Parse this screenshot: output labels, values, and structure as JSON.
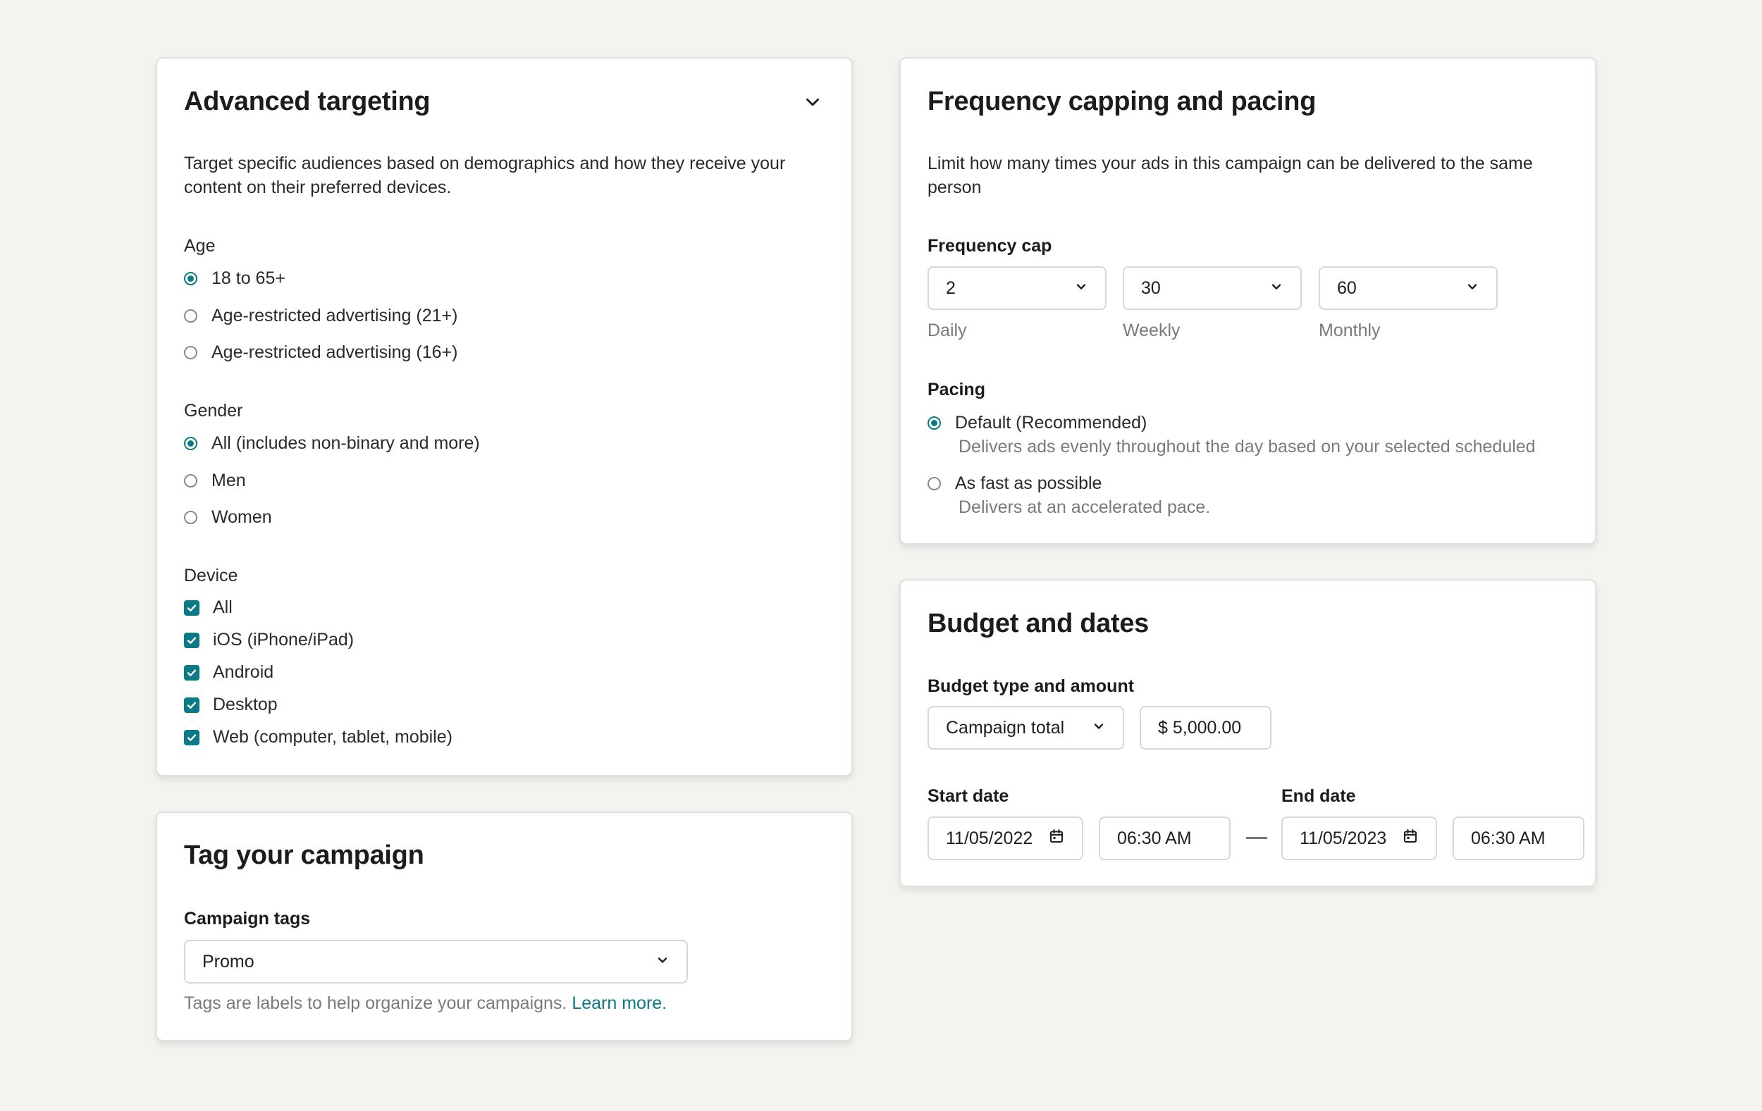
{
  "advanced_targeting": {
    "title": "Advanced targeting",
    "description": "Target specific audiences based on demographics and how they receive your content on their preferred devices.",
    "age": {
      "label": "Age",
      "options": [
        "18 to 65+",
        "Age-restricted advertising (21+)",
        "Age-restricted advertising (16+)"
      ],
      "selected": 0
    },
    "gender": {
      "label": "Gender",
      "options": [
        "All (includes non-binary and more)",
        "Men",
        "Women"
      ],
      "selected": 0
    },
    "device": {
      "label": "Device",
      "options": [
        "All",
        "iOS (iPhone/iPad)",
        "Android",
        "Desktop",
        "Web (computer, tablet, mobile)"
      ],
      "checked": [
        true,
        true,
        true,
        true,
        true
      ]
    },
    "toggle_icon": "chevron-down-icon"
  },
  "tag_campaign": {
    "title": "Tag your campaign",
    "tags_label": "Campaign tags",
    "tags_value": "Promo",
    "hint_text": "Tags are labels to help organize your campaigns.",
    "learn_more": "Learn more."
  },
  "frequency": {
    "title": "Frequency capping and pacing",
    "description": "Limit how many times your ads in this campaign can be delivered to the same person",
    "cap_label": "Frequency cap",
    "caps": [
      {
        "value": "2",
        "label": "Daily"
      },
      {
        "value": "30",
        "label": "Weekly"
      },
      {
        "value": "60",
        "label": "Monthly"
      }
    ],
    "pacing_label": "Pacing",
    "pacing_options": [
      {
        "label": "Default (Recommended)",
        "sub": "Delivers ads evenly throughout the day based on your selected scheduled"
      },
      {
        "label": "As fast as possible",
        "sub": "Delivers at an accelerated pace."
      }
    ],
    "pacing_selected": 0
  },
  "budget": {
    "title": "Budget and dates",
    "type_label": "Budget type and amount",
    "type_value": "Campaign total",
    "amount_value": "$ 5,000.00",
    "start_label": "Start date",
    "start_date": "11/05/2022",
    "start_time": "06:30 AM",
    "separator": "—",
    "end_label": "End date",
    "end_date": "11/05/2023",
    "end_time": "06:30 AM"
  },
  "colors": {
    "accent": "#0b7a87",
    "background": "#f4f3f0",
    "card": "#ffffff",
    "border": "#d9d7d3",
    "muted_text": "#7a7a7a"
  }
}
